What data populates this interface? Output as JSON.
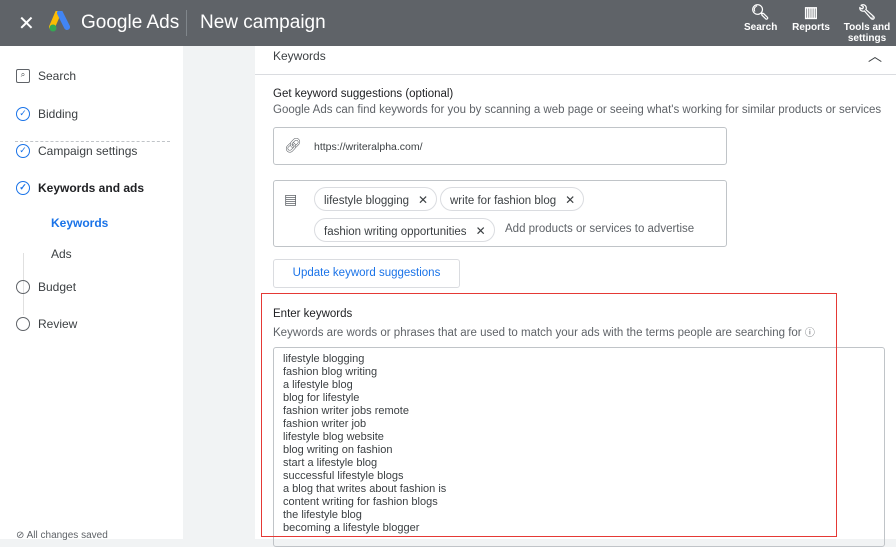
{
  "topbar": {
    "brand": "Google Ads",
    "title": "New campaign",
    "tools": [
      {
        "label": "Search",
        "icon": "search-icon"
      },
      {
        "label": "Reports",
        "icon": "reports-icon"
      },
      {
        "label": "Tools and settings",
        "icon": "wrench-icon"
      }
    ]
  },
  "sidebar": {
    "campaign_type": "Search",
    "items": [
      {
        "label": "Bidding",
        "state": "done"
      },
      {
        "label": "Campaign settings",
        "state": "done"
      },
      {
        "label": "Keywords and ads",
        "state": "done"
      },
      {
        "label": "Budget",
        "state": "todo"
      },
      {
        "label": "Review",
        "state": "todo"
      }
    ],
    "subitems": [
      {
        "label": "Keywords",
        "active": true
      },
      {
        "label": "Ads",
        "active": false
      }
    ],
    "status": "All changes saved"
  },
  "main": {
    "section_title": "Keywords",
    "suggestions": {
      "title": "Get keyword suggestions (optional)",
      "description": "Google Ads can find keywords for you by scanning a web page or seeing what's working for similar products or services",
      "url": "https://writeralpha.com/",
      "chips": [
        "lifestyle blogging",
        "write for fashion blog",
        "fashion writing opportunities"
      ],
      "chips_placeholder": "Add products or services to advertise",
      "update_button": "Update keyword suggestions"
    },
    "enter": {
      "title": "Enter keywords",
      "description": "Keywords are words or phrases that are used to match your ads with the terms people are searching for",
      "keywords": [
        "lifestyle blogging",
        "fashion blog writing",
        "a lifestyle blog",
        "blog for lifestyle",
        "fashion writer jobs remote",
        "fashion writer job",
        "lifestyle blog website",
        "blog writing on fashion",
        "start a lifestyle blog",
        "successful lifestyle blogs",
        "a blog that writes about fashion is",
        "content writing for fashion blogs",
        "the lifestyle blog",
        "becoming a lifestyle blogger"
      ]
    }
  },
  "colors": {
    "topbar": "#5f6368",
    "accent": "#1a73e8",
    "highlight": "#e53935"
  }
}
